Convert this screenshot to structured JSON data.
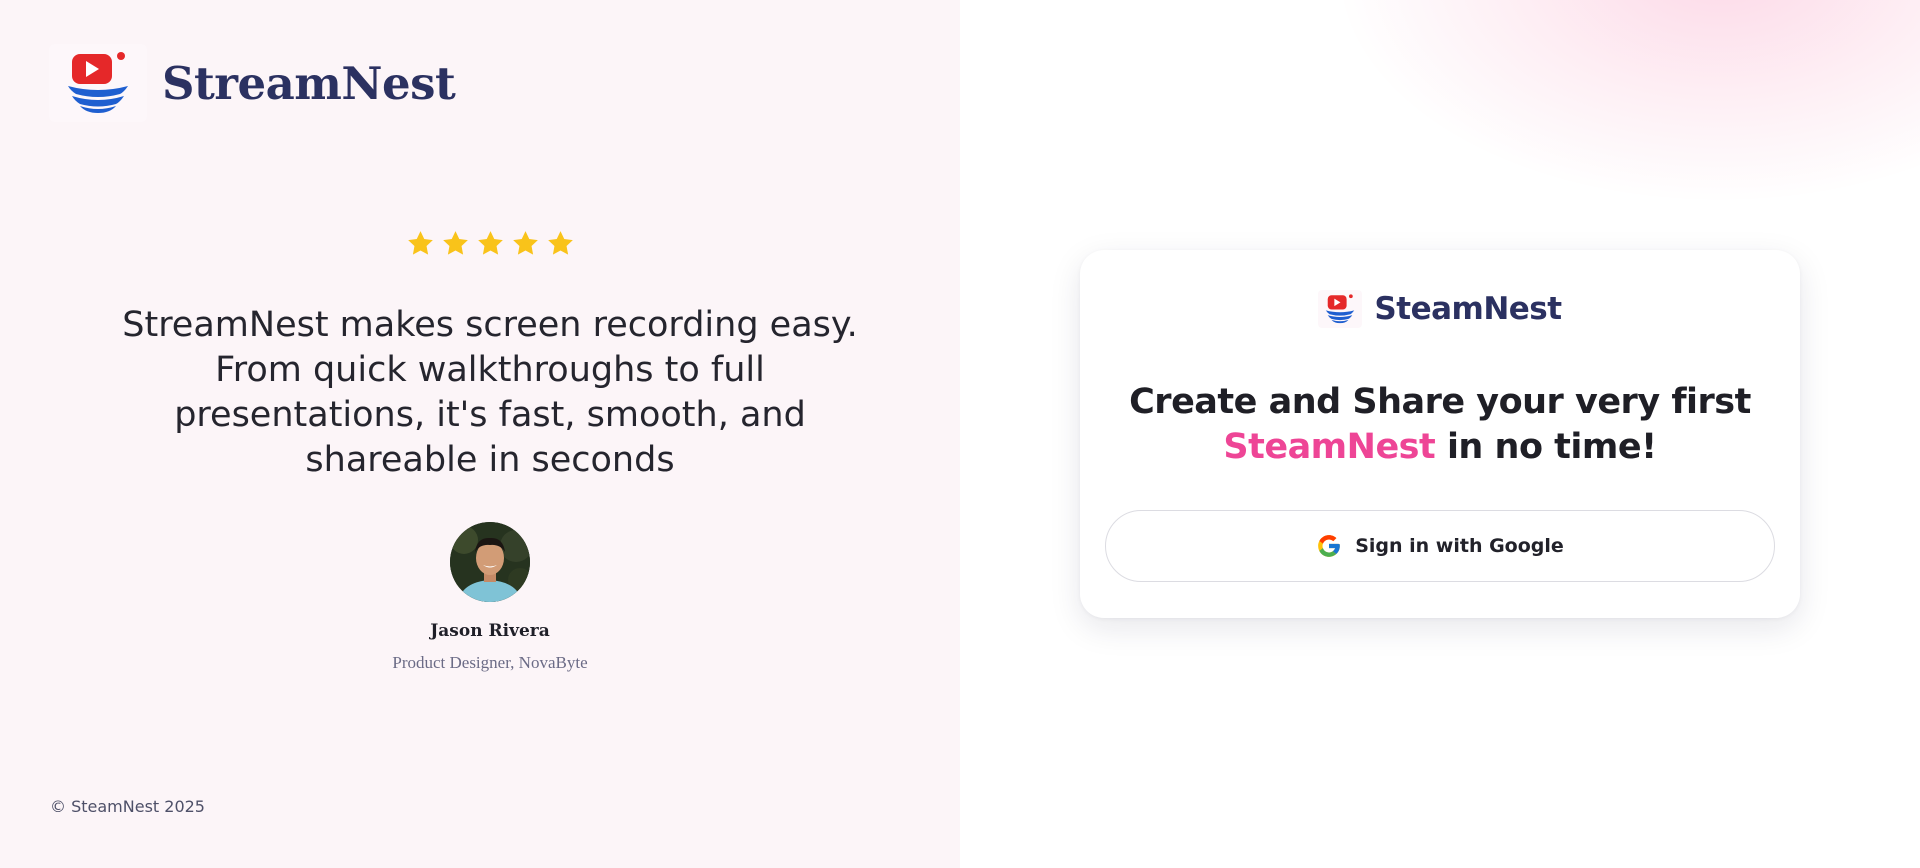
{
  "brand": {
    "name": "StreamNest",
    "logo_icon": "play-boat-logo-icon",
    "color": "#2b3161"
  },
  "testimonial": {
    "rating": 5,
    "rating_max": 5,
    "star_color": "#f9c31a",
    "quote": "StreamNest makes screen recording easy. From quick walkthroughs to full presentations, it's fast, smooth, and shareable in seconds",
    "author_name": "Jason Rivera",
    "author_role": "Product Designer, NovaByte"
  },
  "footer": {
    "copyright": "© SteamNest 2025"
  },
  "signin_card": {
    "brand_name": "SteamNest",
    "title_prefix": "Create and Share your very first",
    "title_accent": "SteamNest",
    "title_suffix": "in no time!",
    "accent_color": "#ee4596",
    "google_button_label": "Sign in with Google",
    "google_icon": "google-g-icon"
  }
}
